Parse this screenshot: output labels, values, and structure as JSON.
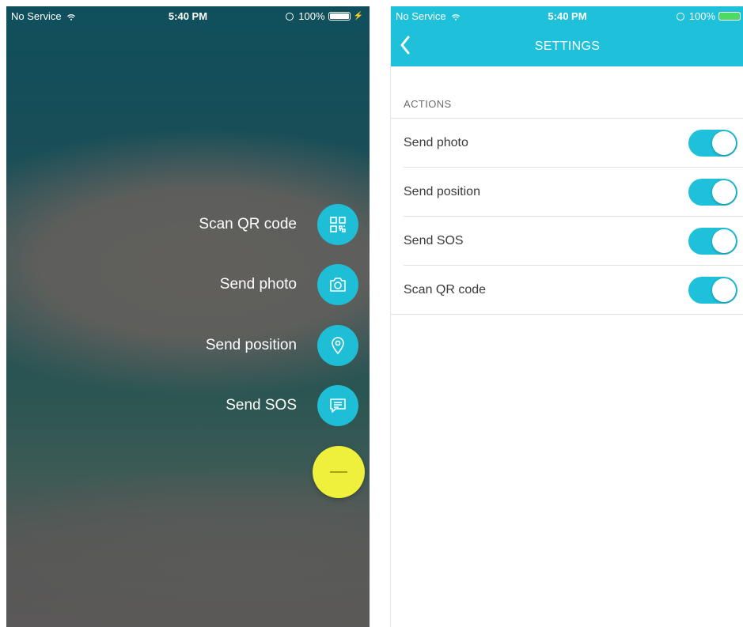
{
  "left_screen": {
    "status": {
      "carrier": "No Service",
      "time": "5:40 PM",
      "battery": "100%"
    },
    "actions": [
      {
        "label": "Scan QR code",
        "icon": "qr-code-icon"
      },
      {
        "label": "Send photo",
        "icon": "camera-icon"
      },
      {
        "label": "Send position",
        "icon": "location-pin-icon"
      },
      {
        "label": "Send SOS",
        "icon": "message-icon"
      }
    ],
    "main_fab": {
      "icon": "minus-icon",
      "color": "#eef03b"
    },
    "accent": "#1ebfd6"
  },
  "right_screen": {
    "status": {
      "carrier": "No Service",
      "time": "5:40 PM",
      "battery": "100%"
    },
    "nav": {
      "title": "SETTINGS",
      "back_icon": "chevron-left-icon"
    },
    "section_header": "ACTIONS",
    "rows": [
      {
        "label": "Send photo",
        "enabled": true
      },
      {
        "label": "Send position",
        "enabled": true
      },
      {
        "label": "Send SOS",
        "enabled": true
      },
      {
        "label": "Scan QR code",
        "enabled": true
      }
    ],
    "accent": "#1ec1d9"
  }
}
